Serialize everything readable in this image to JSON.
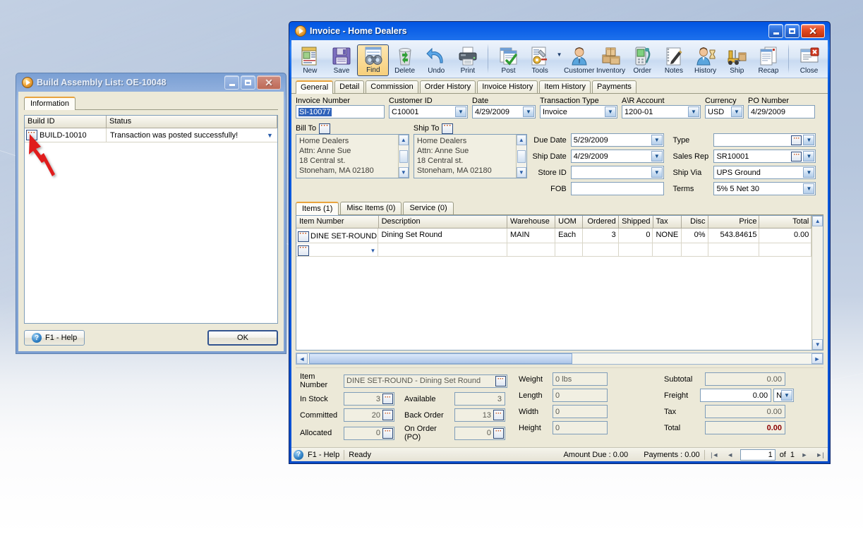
{
  "build_window": {
    "title": "Build Assembly List: OE-10048",
    "icon": "play-circle-icon",
    "buttons": {
      "minimize": "minimize-icon",
      "maximize": "maximize-icon",
      "close": "close-icon"
    },
    "tabs": [
      {
        "label": "Information",
        "active": true
      }
    ],
    "grid": {
      "columns": [
        "Build ID",
        "Status"
      ],
      "rows": [
        {
          "build_id": "BUILD-10010",
          "status": "Transaction was posted successfully!"
        }
      ]
    },
    "footer": {
      "help": "F1 - Help",
      "ok": "OK"
    }
  },
  "invoice_window": {
    "title": "Invoice  - Home Dealers",
    "icon": "play-circle-icon",
    "buttons": {
      "minimize": "minimize-icon",
      "maximize": "maximize-icon",
      "close": "close-icon"
    },
    "toolbar": [
      {
        "label": "New",
        "icon": "new-document-icon",
        "selected": false
      },
      {
        "label": "Save",
        "icon": "floppy-disk-icon",
        "selected": false
      },
      {
        "label": "Find",
        "icon": "binoculars-icon",
        "selected": true
      },
      {
        "label": "Delete",
        "icon": "trash-recycle-icon",
        "selected": false
      },
      {
        "label": "Undo",
        "icon": "undo-arrow-icon",
        "selected": false
      },
      {
        "label": "Print",
        "icon": "printer-icon",
        "selected": false
      },
      {
        "label": "Post",
        "icon": "post-checkmark-icon",
        "selected": false
      },
      {
        "label": "Tools",
        "icon": "tools-wrench-icon",
        "selected": false
      },
      {
        "label": "Customer",
        "icon": "customer-person-icon",
        "selected": false
      },
      {
        "label": "Inventory",
        "icon": "boxes-inventory-icon",
        "selected": false
      },
      {
        "label": "Order",
        "icon": "order-device-icon",
        "selected": false
      },
      {
        "label": "Notes",
        "icon": "notepad-pen-icon",
        "selected": false
      },
      {
        "label": "History",
        "icon": "history-hourglass-icon",
        "selected": false
      },
      {
        "label": "Ship",
        "icon": "forklift-ship-icon",
        "selected": false
      },
      {
        "label": "Recap",
        "icon": "recap-report-icon",
        "selected": false
      },
      {
        "label": "Close",
        "icon": "close-window-icon",
        "selected": false
      }
    ],
    "tabs": [
      {
        "label": "General",
        "active": true
      },
      {
        "label": "Detail",
        "active": false
      },
      {
        "label": "Commission",
        "active": false
      },
      {
        "label": "Order History",
        "active": false
      },
      {
        "label": "Invoice History",
        "active": false
      },
      {
        "label": "Item History",
        "active": false
      },
      {
        "label": "Payments",
        "active": false
      }
    ],
    "header_fields": {
      "invoice_number": {
        "label": "Invoice Number",
        "value": "SI-10077",
        "selected": true
      },
      "customer_id": {
        "label": "Customer ID",
        "value": "C10001"
      },
      "date": {
        "label": "Date",
        "value": "4/29/2009"
      },
      "transaction_type": {
        "label": "Transaction Type",
        "value": "Invoice"
      },
      "ar_account": {
        "label": "A\\R Account",
        "value": "1200-01"
      },
      "currency": {
        "label": "Currency",
        "value": "USD"
      },
      "po_number": {
        "label": "PO Number",
        "value": "4/29/2009"
      }
    },
    "bill_to": {
      "label": "Bill To",
      "lines": [
        "Home Dealers",
        "Attn: Anne Sue",
        "18 Central st.",
        "Stoneham, MA 02180"
      ]
    },
    "ship_to": {
      "label": "Ship To",
      "lines": [
        "Home Dealers",
        "Attn: Anne Sue",
        "18 Central st.",
        "Stoneham, MA 02180"
      ]
    },
    "shipping_fields": {
      "due_date": {
        "label": "Due Date",
        "value": "5/29/2009"
      },
      "ship_date": {
        "label": "Ship Date",
        "value": "4/29/2009"
      },
      "store_id": {
        "label": "Store ID",
        "value": ""
      },
      "fob": {
        "label": "FOB",
        "value": ""
      },
      "type": {
        "label": "Type",
        "value": ""
      },
      "sales_rep": {
        "label": "Sales Rep",
        "value": "SR10001"
      },
      "ship_via": {
        "label": "Ship Via",
        "value": "UPS Ground"
      },
      "terms": {
        "label": "Terms",
        "value": "5% 5 Net 30"
      }
    },
    "items_tabs": [
      {
        "label": "Items (1)",
        "active": true
      },
      {
        "label": "Misc Items (0)",
        "active": false
      },
      {
        "label": "Service (0)",
        "active": false
      }
    ],
    "items_grid": {
      "columns": [
        "Item Number",
        "Description",
        "Warehouse",
        "UOM",
        "Ordered",
        "Shipped",
        "Tax",
        "Disc",
        "Price",
        "Total"
      ],
      "rows": [
        {
          "item_number": "DINE SET-ROUND",
          "description": "Dining Set Round",
          "warehouse": "MAIN",
          "uom": "Each",
          "ordered": "3",
          "shipped": "0",
          "tax": "NONE",
          "disc": "0%",
          "price": "543.84615",
          "total": "0.00"
        }
      ]
    },
    "detail_panel": {
      "item_number": {
        "label": "Item Number",
        "value": "DINE SET-ROUND - Dining Set Round"
      },
      "in_stock": {
        "label": "In Stock",
        "value": "3"
      },
      "committed": {
        "label": "Committed",
        "value": "20"
      },
      "allocated": {
        "label": "Allocated",
        "value": "0"
      },
      "available": {
        "label": "Available",
        "value": "3"
      },
      "back_order": {
        "label": "Back Order",
        "value": "13"
      },
      "on_order_po": {
        "label": "On Order (PO)",
        "value": "0"
      },
      "weight": {
        "label": "Weight",
        "value": "0 lbs"
      },
      "length": {
        "label": "Length",
        "value": "0"
      },
      "width": {
        "label": "Width",
        "value": "0"
      },
      "height": {
        "label": "Height",
        "value": "0"
      },
      "subtotal": {
        "label": "Subtotal",
        "value": "0.00"
      },
      "freight": {
        "label": "Freight",
        "value": "0.00",
        "flag": "N"
      },
      "tax": {
        "label": "Tax",
        "value": "0.00"
      },
      "total": {
        "label": "Total",
        "value": "0.00"
      }
    },
    "statusbar": {
      "help": "F1 - Help",
      "status": "Ready",
      "amount_due": "Amount Due : 0.00",
      "payments": "Payments : 0.00",
      "page_current": "1",
      "page_of": "of",
      "page_total": "1"
    }
  },
  "annotation": {
    "arrow": "red-arrow-pointer",
    "color": "#e01b1b"
  }
}
